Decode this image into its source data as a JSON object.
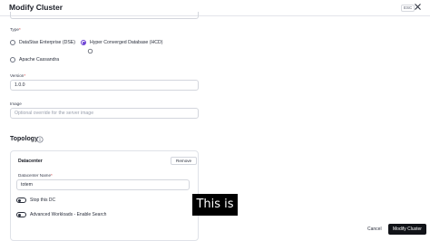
{
  "header": {
    "title": "Modify Cluster",
    "esc_label": "ESC"
  },
  "type_field": {
    "label": "Type",
    "required_mark": "*",
    "options": [
      {
        "label": "DataStax Enterprise (DSE)",
        "selected": false
      },
      {
        "label": "Hyper Converged Database (HCD)",
        "selected": true
      },
      {
        "label": "Apache Cassandra",
        "selected": false
      }
    ]
  },
  "version_field": {
    "label": "Version",
    "required_mark": "*",
    "value": "1.0.0"
  },
  "image_field": {
    "label": "Image",
    "placeholder": "Optional override for the server image"
  },
  "topology": {
    "title": "Topology",
    "datacenter": {
      "title": "Datacenter",
      "remove_label": "Remove",
      "name_label": "Datacenter Name",
      "required_mark": "*",
      "name_value": "totem",
      "toggles": [
        {
          "label": "Stop this DC"
        },
        {
          "label": "Advanced Workloads - Enable Search"
        }
      ]
    }
  },
  "caption": "This is",
  "footer": {
    "cancel_label": "Cancel",
    "submit_label": "Modify Cluster"
  },
  "colors": {
    "accent": "#6b3fd4",
    "primary_button": "#111318"
  }
}
